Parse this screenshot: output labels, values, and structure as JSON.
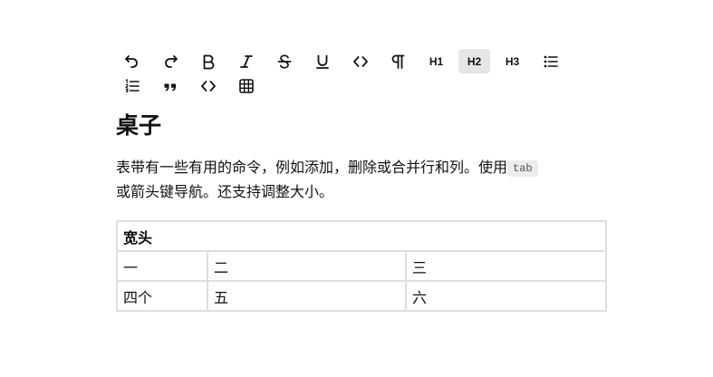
{
  "toolbar": {
    "buttons": [
      {
        "name": "undo",
        "icon": "undo-icon"
      },
      {
        "name": "redo",
        "icon": "redo-icon"
      },
      {
        "name": "bold",
        "icon": "bold-icon",
        "label": "B"
      },
      {
        "name": "italic",
        "icon": "italic-icon"
      },
      {
        "name": "strike",
        "icon": "strikethrough-icon"
      },
      {
        "name": "underline",
        "icon": "underline-icon"
      },
      {
        "name": "code",
        "icon": "code-icon"
      },
      {
        "name": "paragraph",
        "icon": "pilcrow-icon"
      },
      {
        "name": "heading-1",
        "label": "H1"
      },
      {
        "name": "heading-2",
        "label": "H2",
        "active": true
      },
      {
        "name": "heading-3",
        "label": "H3"
      },
      {
        "name": "bullet-list",
        "icon": "bullet-list-icon"
      },
      {
        "name": "ordered-list",
        "icon": "ordered-list-icon"
      },
      {
        "name": "blockquote",
        "icon": "quote-icon"
      },
      {
        "name": "code-block",
        "icon": "code-block-icon"
      },
      {
        "name": "table",
        "icon": "table-icon"
      }
    ],
    "active_color": "#e6e6e6"
  },
  "document": {
    "heading": "桌子",
    "paragraph_before": "表带有一些有用的命令，例如添加，删除或合并行和列。使用",
    "code_text": "tab",
    "paragraph_after": "或箭头键导航。还支持调整大小。",
    "table": {
      "header": "宽头",
      "rows": [
        [
          "一",
          "二",
          "三"
        ],
        [
          "四个",
          "五",
          "六"
        ]
      ]
    }
  }
}
